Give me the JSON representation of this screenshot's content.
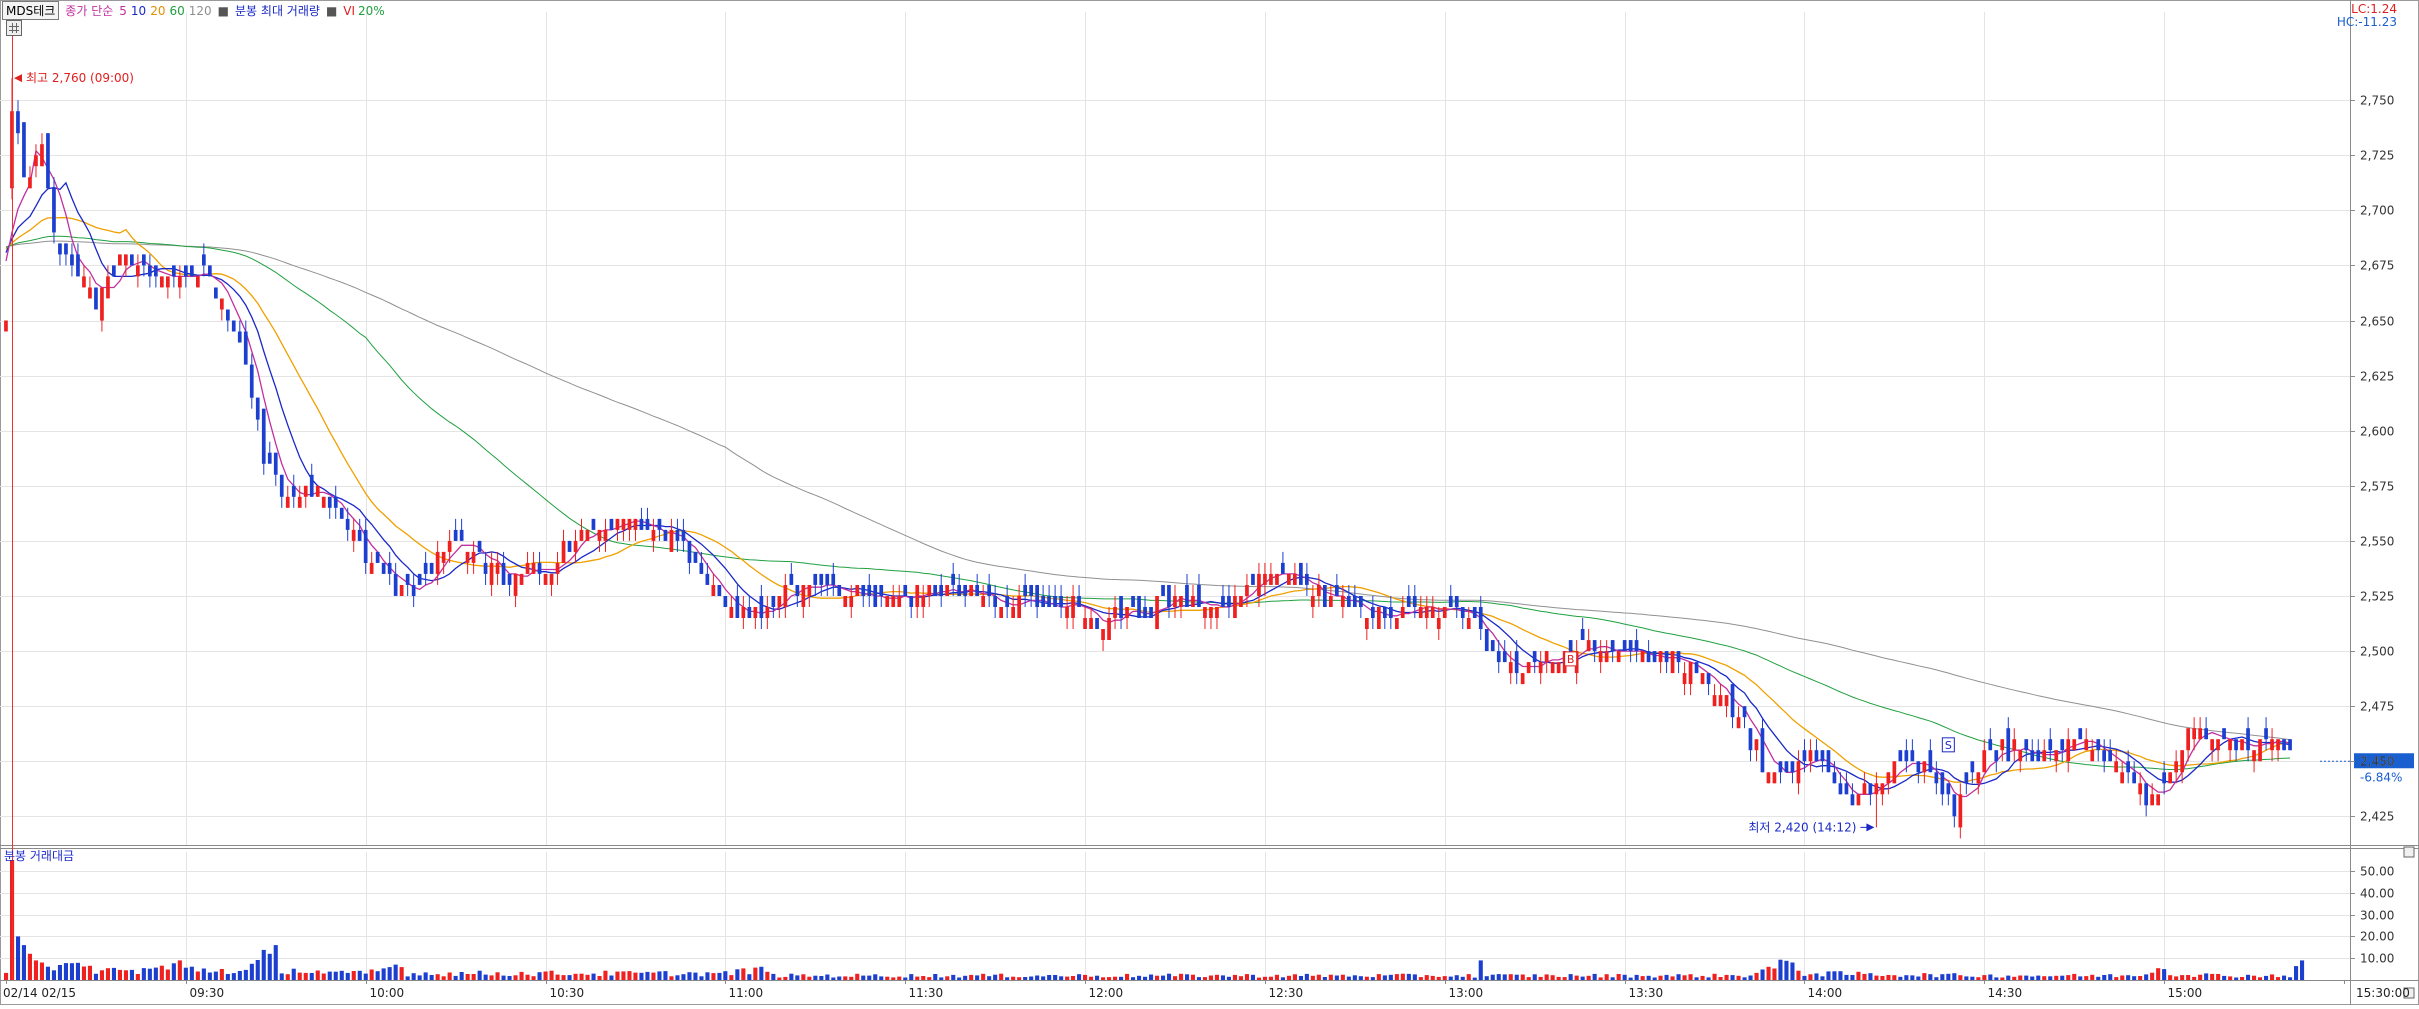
{
  "toolbar": {
    "stock_name": "MDS테크",
    "ma_label": "종가 단순",
    "ma_periods": [
      "5",
      "10",
      "20",
      "60",
      "120"
    ],
    "volume_label": "분봉 최대 거래량",
    "vi_label": "VI",
    "vi_value": "20%"
  },
  "corner": {
    "lc": "LC:1.24",
    "hc": "HC:-11.23"
  },
  "sub_chart_title": "분봉 거래대금",
  "colors": {
    "up": "#ee2020",
    "down": "#1c3fd0",
    "ma5": "#c030a0",
    "ma10": "#1a28c8",
    "ma20": "#f0a000",
    "ma60": "#20a040",
    "ma120": "#909090",
    "grid": "#e4e4e4",
    "axis": "#8a8a8a",
    "price_tag": "#1a5fd0"
  },
  "chart_data": [
    {
      "type": "candlestick",
      "title": "MDS테크 1-minute",
      "y_ticks": [
        "2,750",
        "2,725",
        "2,700",
        "2,675",
        "2,650",
        "2,625",
        "2,600",
        "2,575",
        "2,550",
        "2,525",
        "2,500",
        "2,475",
        "2,450",
        "2,425"
      ],
      "ylim": [
        2412,
        2790
      ],
      "x_range_minutes": [
        0,
        390
      ],
      "x_ticks": [
        {
          "minute": 0,
          "label": "02/14 02/15"
        },
        {
          "minute": 30,
          "label": "09:30"
        },
        {
          "minute": 60,
          "label": "10:00"
        },
        {
          "minute": 90,
          "label": "10:30"
        },
        {
          "minute": 120,
          "label": "11:00"
        },
        {
          "minute": 150,
          "label": "11:30"
        },
        {
          "minute": 180,
          "label": "12:00"
        },
        {
          "minute": 210,
          "label": "12:30"
        },
        {
          "minute": 240,
          "label": "13:00"
        },
        {
          "minute": 270,
          "label": "13:30"
        },
        {
          "minute": 300,
          "label": "14:00"
        },
        {
          "minute": 330,
          "label": "14:30"
        },
        {
          "minute": 360,
          "label": "15:00"
        },
        {
          "minute": 390,
          "label": "15:30:00"
        }
      ],
      "price_anchors": [
        [
          0,
          2650
        ],
        [
          1,
          2745
        ],
        [
          3,
          2715
        ],
        [
          6,
          2730
        ],
        [
          8,
          2690
        ],
        [
          12,
          2672
        ],
        [
          15,
          2660
        ],
        [
          19,
          2680
        ],
        [
          22,
          2675
        ],
        [
          25,
          2672
        ],
        [
          28,
          2668
        ],
        [
          30,
          2672
        ],
        [
          33,
          2670
        ],
        [
          36,
          2660
        ],
        [
          39,
          2640
        ],
        [
          43,
          2590
        ],
        [
          46,
          2570
        ],
        [
          49,
          2568
        ],
        [
          52,
          2575
        ],
        [
          56,
          2562
        ],
        [
          59,
          2548
        ],
        [
          62,
          2540
        ],
        [
          65,
          2530
        ],
        [
          68,
          2528
        ],
        [
          71,
          2538
        ],
        [
          74,
          2550
        ],
        [
          77,
          2546
        ],
        [
          80,
          2540
        ],
        [
          83,
          2534
        ],
        [
          86,
          2538
        ],
        [
          89,
          2532
        ],
        [
          92,
          2540
        ],
        [
          95,
          2552
        ],
        [
          98,
          2556
        ],
        [
          101,
          2558
        ],
        [
          104,
          2560
        ],
        [
          107,
          2556
        ],
        [
          110,
          2554
        ],
        [
          113,
          2548
        ],
        [
          116,
          2536
        ],
        [
          119,
          2524
        ],
        [
          122,
          2516
        ],
        [
          125,
          2518
        ],
        [
          128,
          2522
        ],
        [
          131,
          2528
        ],
        [
          134,
          2530
        ],
        [
          137,
          2530
        ],
        [
          140,
          2528
        ],
        [
          143,
          2526
        ],
        [
          146,
          2524
        ],
        [
          149,
          2524
        ],
        [
          152,
          2526
        ],
        [
          155,
          2528
        ],
        [
          158,
          2527
        ],
        [
          161,
          2524
        ],
        [
          164,
          2522
        ],
        [
          167,
          2520
        ],
        [
          170,
          2522
        ],
        [
          173,
          2524
        ],
        [
          176,
          2522
        ],
        [
          179,
          2518
        ],
        [
          182,
          2514
        ],
        [
          185,
          2516
        ],
        [
          188,
          2518
        ],
        [
          191,
          2520
        ],
        [
          194,
          2522
        ],
        [
          197,
          2524
        ],
        [
          200,
          2522
        ],
        [
          203,
          2522
        ],
        [
          206,
          2528
        ],
        [
          209,
          2538
        ],
        [
          212,
          2536
        ],
        [
          215,
          2532
        ],
        [
          218,
          2528
        ],
        [
          221,
          2524
        ],
        [
          224,
          2520
        ],
        [
          227,
          2518
        ],
        [
          230,
          2518
        ],
        [
          233,
          2518
        ],
        [
          236,
          2518
        ],
        [
          239,
          2518
        ],
        [
          242,
          2518
        ],
        [
          245,
          2516
        ],
        [
          248,
          2500
        ],
        [
          251,
          2494
        ],
        [
          254,
          2492
        ],
        [
          257,
          2496
        ],
        [
          260,
          2500
        ],
        [
          263,
          2502
        ],
        [
          266,
          2500
        ],
        [
          269,
          2498
        ],
        [
          272,
          2498
        ],
        [
          275,
          2497
        ],
        [
          278,
          2496
        ],
        [
          281,
          2492
        ],
        [
          284,
          2486
        ],
        [
          287,
          2478
        ],
        [
          290,
          2466
        ],
        [
          293,
          2450
        ],
        [
          296,
          2444
        ],
        [
          299,
          2448
        ],
        [
          302,
          2452
        ],
        [
          305,
          2444
        ],
        [
          308,
          2428
        ],
        [
          311,
          2440
        ],
        [
          314,
          2444
        ],
        [
          317,
          2448
        ],
        [
          320,
          2446
        ],
        [
          323,
          2440
        ],
        [
          325,
          2426
        ],
        [
          327,
          2440
        ],
        [
          330,
          2452
        ],
        [
          333,
          2456
        ],
        [
          336,
          2454
        ],
        [
          339,
          2452
        ],
        [
          342,
          2456
        ],
        [
          345,
          2458
        ],
        [
          348,
          2455
        ],
        [
          351,
          2452
        ],
        [
          354,
          2446
        ],
        [
          357,
          2434
        ],
        [
          360,
          2440
        ],
        [
          362,
          2450
        ],
        [
          364,
          2466
        ],
        [
          366,
          2468
        ],
        [
          368,
          2460
        ],
        [
          371,
          2458
        ],
        [
          374,
          2456
        ],
        [
          377,
          2458
        ],
        [
          380,
          2456
        ],
        [
          381,
          2454
        ]
      ],
      "moving_averages": [
        "5",
        "10",
        "20",
        "60",
        "120"
      ],
      "annotations": [
        {
          "text": "최고 2,760 (09:00)",
          "minute": 1,
          "price": 2760
        },
        {
          "text": "최저 2,420 (14:12)",
          "minute": 312,
          "price": 2420
        }
      ],
      "markers": [
        {
          "letter": "B",
          "minute": 261,
          "price": 2496
        },
        {
          "letter": "S",
          "minute": 324,
          "price": 2457
        }
      ],
      "current_price": "2,450",
      "current_change": "-6.84%",
      "current_value": 2450
    },
    {
      "type": "bar",
      "title": "분봉 거래대금",
      "y_ticks": [
        "50.00",
        "40.00",
        "30.00",
        "20.00",
        "10.00"
      ],
      "ylim": [
        0,
        55
      ],
      "volume_profile": [
        [
          0,
          4
        ],
        [
          1,
          55
        ],
        [
          2,
          20
        ],
        [
          3,
          16
        ],
        [
          4,
          12
        ],
        [
          5,
          9
        ],
        [
          6,
          8
        ],
        [
          7,
          7
        ],
        [
          10,
          6
        ],
        [
          15,
          5
        ],
        [
          20,
          4
        ],
        [
          28,
          6
        ],
        [
          29,
          9
        ],
        [
          30,
          5
        ],
        [
          40,
          4
        ],
        [
          44,
          12
        ],
        [
          45,
          16
        ],
        [
          46,
          5
        ],
        [
          55,
          3
        ],
        [
          60,
          3
        ],
        [
          66,
          7
        ],
        [
          67,
          3
        ],
        [
          90,
          3
        ],
        [
          120,
          3
        ],
        [
          127,
          5
        ],
        [
          128,
          2
        ],
        [
          150,
          2
        ],
        [
          180,
          2
        ],
        [
          210,
          2
        ],
        [
          240,
          2
        ],
        [
          245,
          2
        ],
        [
          246,
          9
        ],
        [
          247,
          2
        ],
        [
          260,
          2
        ],
        [
          290,
          2
        ],
        [
          298,
          8
        ],
        [
          299,
          6
        ],
        [
          300,
          3
        ],
        [
          330,
          2
        ],
        [
          355,
          2
        ],
        [
          360,
          6
        ],
        [
          361,
          3
        ],
        [
          370,
          2
        ],
        [
          381,
          2
        ],
        [
          382,
          6
        ],
        [
          383,
          9
        ]
      ]
    }
  ]
}
